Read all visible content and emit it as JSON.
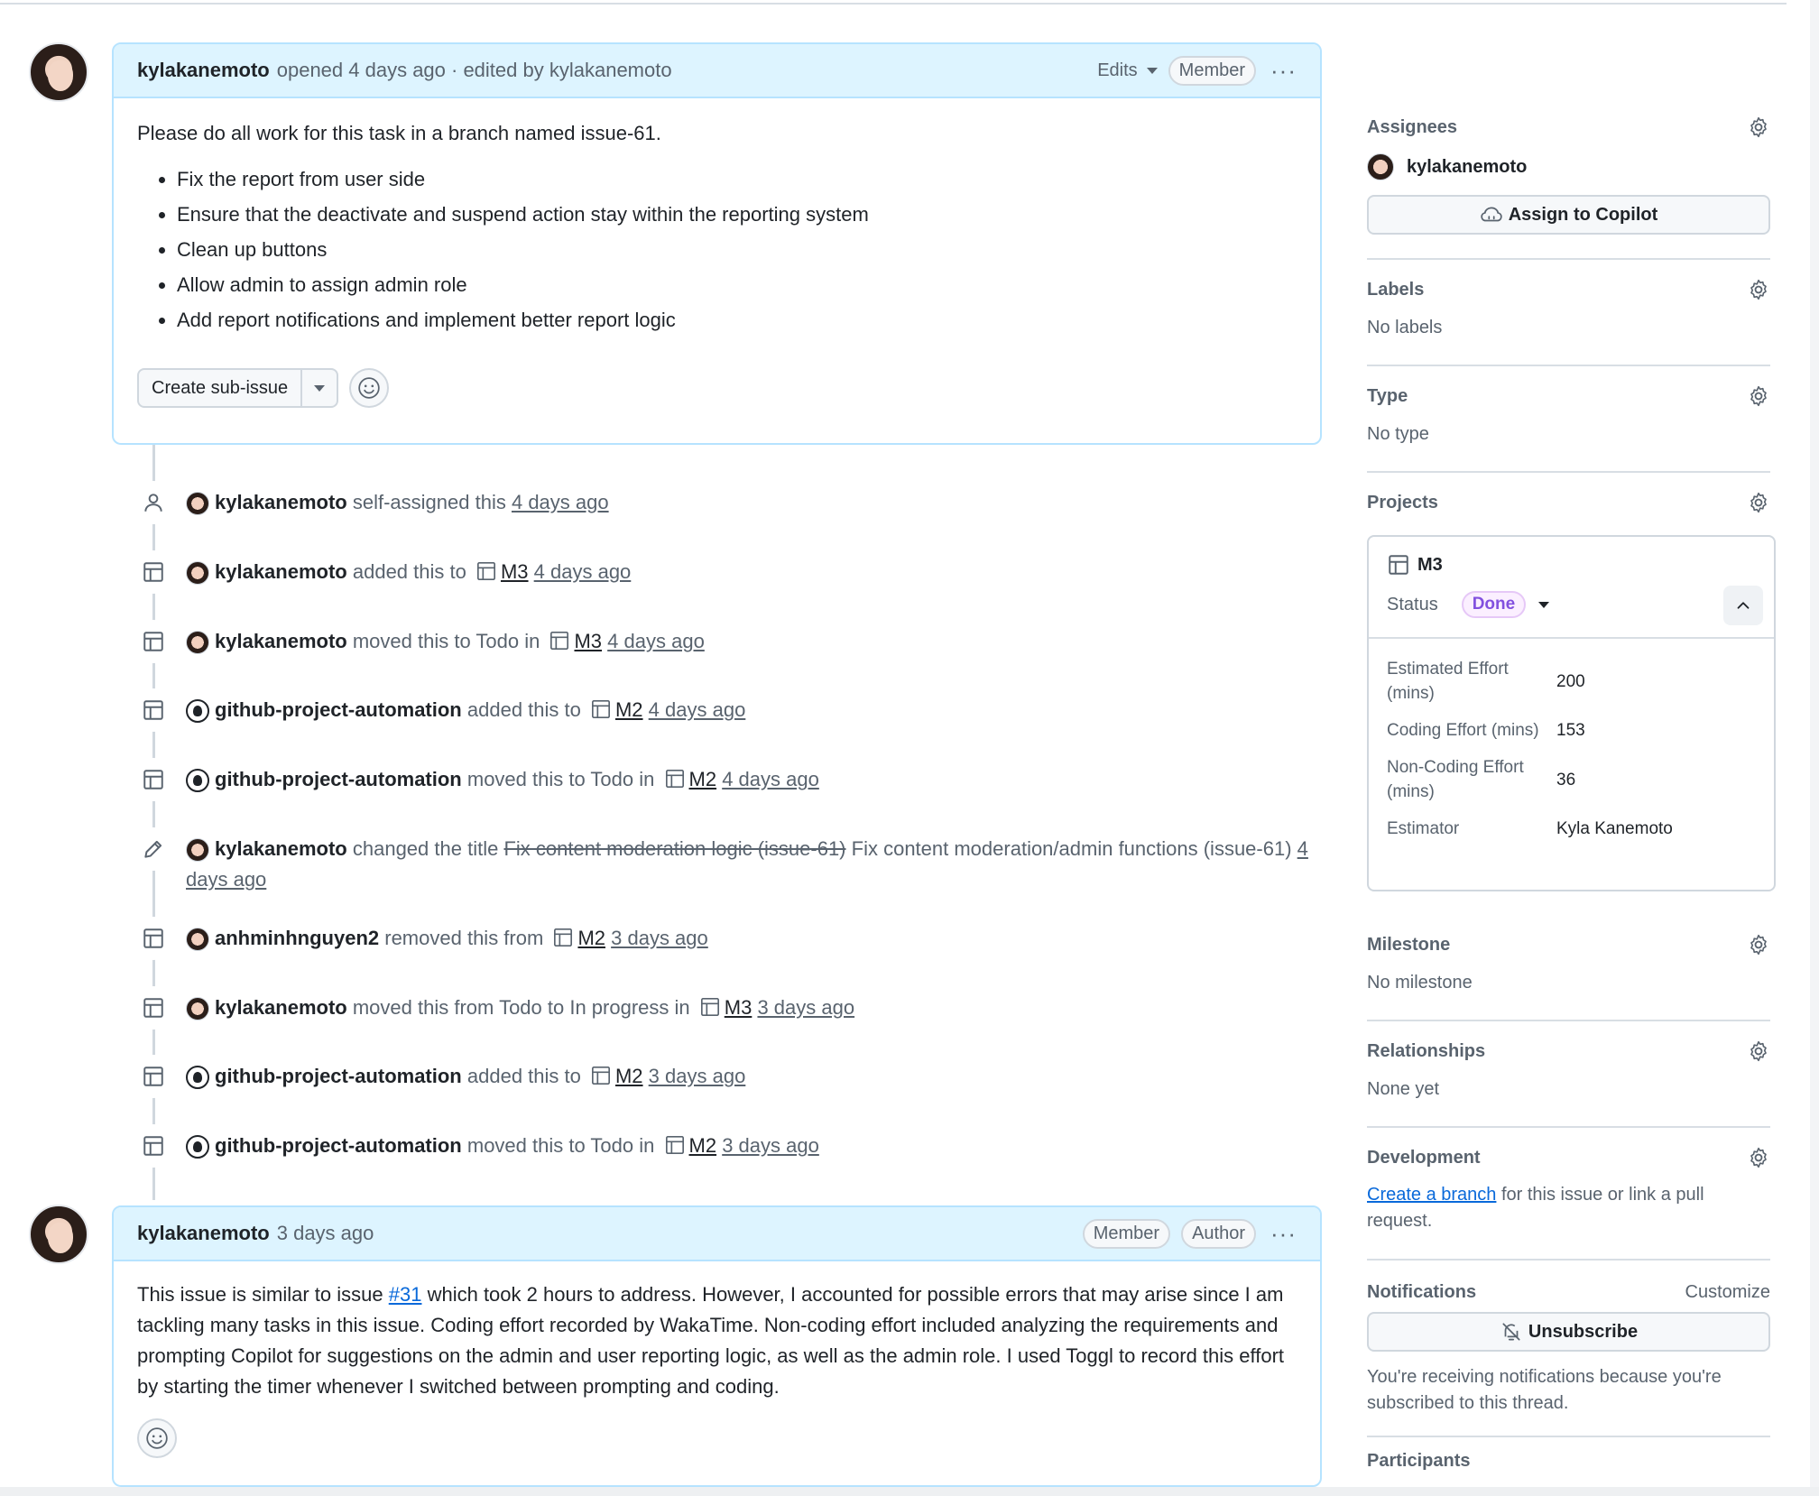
{
  "issue": {
    "author": "kylakanemoto",
    "opened_text": "opened 4 days ago · edited by kylakanemoto",
    "edits_label": "Edits",
    "member_badge": "Member",
    "body_intro": "Please do all work for this task in a branch named issue-61.",
    "tasks": [
      "Fix the report from user side",
      "Ensure that the deactivate and suspend action stay within the reporting system",
      "Clean up buttons",
      "Allow admin to assign admin role",
      "Add report notifications and implement better report logic"
    ],
    "create_sub_issue_label": "Create sub-issue"
  },
  "timeline": [
    {
      "icon": "person-icon",
      "actor": "kylakanemoto",
      "action": "self-assigned this",
      "project": "",
      "time": "4 days ago"
    },
    {
      "icon": "table-icon",
      "actor": "kylakanemoto",
      "action": "added this to",
      "project": "M3",
      "time": "4 days ago"
    },
    {
      "icon": "table-icon",
      "actor": "kylakanemoto",
      "action": "moved this to Todo in",
      "project": "M3",
      "time": "4 days ago"
    },
    {
      "icon": "table-icon",
      "actor": "github-project-automation",
      "action": "added this to",
      "project": "M2",
      "time": "4 days ago"
    },
    {
      "icon": "table-icon",
      "actor": "github-project-automation",
      "action": "moved this to Todo in",
      "project": "M2",
      "time": "4 days ago"
    },
    {
      "icon": "table-icon",
      "actor": "anhminhnguyen2",
      "action": "removed this from",
      "project": "M2",
      "time": "3 days ago"
    },
    {
      "icon": "table-icon",
      "actor": "kylakanemoto",
      "action": "moved this from Todo to In progress in",
      "project": "M3",
      "time": "3 days ago"
    },
    {
      "icon": "table-icon",
      "actor": "github-project-automation",
      "action": "added this to",
      "project": "M2",
      "time": "3 days ago"
    },
    {
      "icon": "table-icon",
      "actor": "github-project-automation",
      "action": "moved this to Todo in",
      "project": "M2",
      "time": "3 days ago"
    }
  ],
  "title_change": {
    "actor": "kylakanemoto",
    "action": "changed the title",
    "old_title": "Fix content moderation logic (issue-61)",
    "new_title": "Fix content moderation/admin functions (issue-61)",
    "time": "4 days ago"
  },
  "comment": {
    "author": "kylakanemoto",
    "time": "3 days ago",
    "member_badge": "Member",
    "author_badge": "Author",
    "text_before_link": "This issue is similar to issue ",
    "link_text": "#31",
    "text_after_link": " which took 2 hours to address. However, I accounted for possible errors that may arise since I am tackling many tasks in this issue. Coding effort recorded by WakaTime. Non-coding effort included analyzing the requirements and prompting Copilot for suggestions on the admin and user reporting logic, as well as the admin role. I used Toggl to record this effort by starting the timer whenever I switched between prompting and coding."
  },
  "sidebar": {
    "assignees_title": "Assignees",
    "assignee": "kylakanemoto",
    "assign_copilot": "Assign to Copilot",
    "labels_title": "Labels",
    "labels_value": "No labels",
    "type_title": "Type",
    "type_value": "No type",
    "projects_title": "Projects",
    "project": {
      "name": "M3",
      "status_label": "Status",
      "status_value": "Done",
      "fields": [
        {
          "key": "Estimated Effort (mins)",
          "value": "200"
        },
        {
          "key": "Coding Effort (mins)",
          "value": "153"
        },
        {
          "key": "Non-Coding Effort (mins)",
          "value": "36"
        },
        {
          "key": "Estimator",
          "value": "Kyla Kanemoto"
        }
      ]
    },
    "milestone_title": "Milestone",
    "milestone_value": "No milestone",
    "relationships_title": "Relationships",
    "relationships_value": "None yet",
    "development_title": "Development",
    "development_link": "Create a branch",
    "development_rest": " for this issue or link a pull request.",
    "notifications_title": "Notifications",
    "customize_label": "Customize",
    "unsubscribe_label": "Unsubscribe",
    "notifications_text": "You're receiving notifications because you're subscribed to this thread.",
    "participants_title": "Participants"
  },
  "colors": {
    "header_bg": "#ddf4ff",
    "border_blue": "#b6e3ff",
    "link": "#0969da",
    "done": "#8250df"
  }
}
